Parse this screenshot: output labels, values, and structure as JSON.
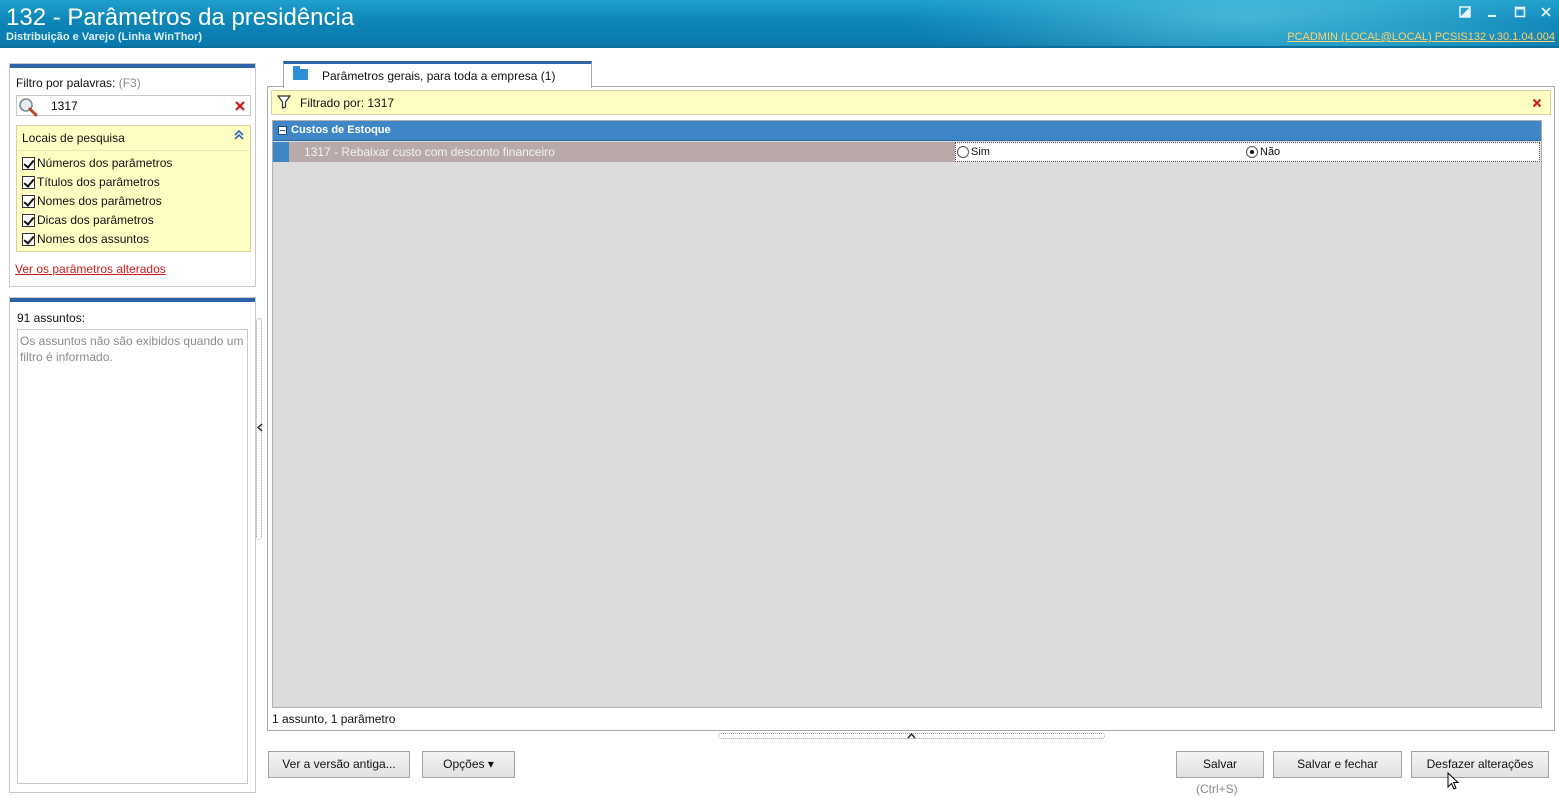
{
  "window": {
    "title": "132 - Parâmetros da presidência",
    "subtitle": "Distribuição e Varejo (Linha WinThor)",
    "user_info": "PCADMIN (LOCAL@LOCAL)  PCSIS132  v.30.1.04.004",
    "controls": [
      "restore-icon",
      "minimize-icon",
      "maximize-icon",
      "close-icon"
    ]
  },
  "filter_panel": {
    "label": "Filtro por palavras:",
    "shortcut": "(F3)",
    "search_value": "1317",
    "search_locations": {
      "header": "Locais de pesquisa",
      "items": [
        {
          "label": "Números dos parâmetros",
          "checked": true
        },
        {
          "label": "Títulos dos parâmetros",
          "checked": true
        },
        {
          "label": "Nomes dos parâmetros",
          "checked": true
        },
        {
          "label": "Dicas dos parâmetros",
          "checked": true
        },
        {
          "label": "Nomes dos assuntos",
          "checked": true
        }
      ]
    },
    "changed_link": "Ver os parâmetros alterados"
  },
  "subjects_panel": {
    "count_label": "91 assuntos:",
    "message": "Os assuntos não são exibidos quando um filtro é informado."
  },
  "main": {
    "tab_label": "Parâmetros gerais, para toda a empresa  (1)",
    "filter_text": "Filtrado por: 1317",
    "group_title": "Custos de Estoque",
    "parameter": {
      "label": "1317 - Rebaixar custo com desconto financeiro",
      "options": [
        "Sim",
        "Não"
      ],
      "selected": "Não"
    },
    "status": "1 assunto, 1 parâmetro"
  },
  "buttons": {
    "old_version": "Ver a versão antiga...",
    "options": "Opções ▾",
    "save": "Salvar",
    "save_hint": "(Ctrl+S)",
    "save_close": "Salvar e fechar",
    "undo": "Desfazer alterações"
  },
  "colors": {
    "title_bar": "#0e86b8",
    "panel_accent": "#2f63a8",
    "yellow_panel": "#ffffc4",
    "group_row": "#3e86c6",
    "link_red": "#cc1a1a"
  }
}
